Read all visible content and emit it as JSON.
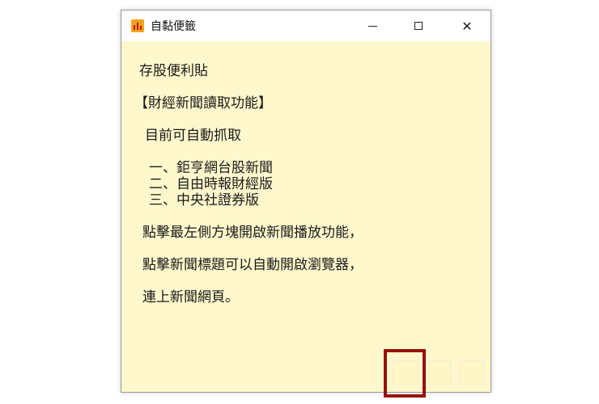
{
  "window": {
    "title": "自黏便籤",
    "controls": {
      "minimize": "minimize-icon",
      "maximize": "maximize-icon",
      "close": "✕"
    }
  },
  "note": {
    "lines": [
      "存股便利貼",
      "【財經新聞讀取功能】",
      "目前可自動抓取",
      "一、鉅亨網台股新聞",
      "二、自由時報財經版",
      "三、中央社證券版",
      "點擊最左側方塊開啟新聞播放功能，",
      "點擊新聞標題可以自動開啟瀏覽器，",
      "連上新聞網頁。"
    ]
  },
  "buttons": {
    "highlighted_index": 0,
    "colors": {
      "note_background": "#fff8cc",
      "highlight_border": "#9b0f0f"
    }
  }
}
